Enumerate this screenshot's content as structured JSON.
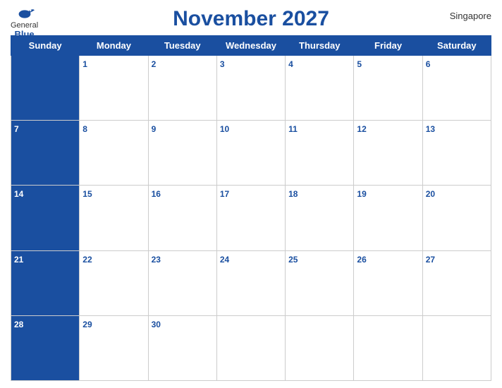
{
  "header": {
    "title": "November 2027",
    "location": "Singapore",
    "logo": {
      "general": "General",
      "blue": "Blue"
    }
  },
  "weekdays": [
    "Sunday",
    "Monday",
    "Tuesday",
    "Wednesday",
    "Thursday",
    "Friday",
    "Saturday"
  ],
  "weeks": [
    [
      {
        "day": "",
        "blue": true
      },
      {
        "day": "1",
        "blue": false
      },
      {
        "day": "2",
        "blue": false
      },
      {
        "day": "3",
        "blue": false
      },
      {
        "day": "4",
        "blue": false
      },
      {
        "day": "5",
        "blue": false
      },
      {
        "day": "6",
        "blue": false
      }
    ],
    [
      {
        "day": "7",
        "blue": true
      },
      {
        "day": "8",
        "blue": false
      },
      {
        "day": "9",
        "blue": false
      },
      {
        "day": "10",
        "blue": false
      },
      {
        "day": "11",
        "blue": false
      },
      {
        "day": "12",
        "blue": false
      },
      {
        "day": "13",
        "blue": false
      }
    ],
    [
      {
        "day": "14",
        "blue": true
      },
      {
        "day": "15",
        "blue": false
      },
      {
        "day": "16",
        "blue": false
      },
      {
        "day": "17",
        "blue": false
      },
      {
        "day": "18",
        "blue": false
      },
      {
        "day": "19",
        "blue": false
      },
      {
        "day": "20",
        "blue": false
      }
    ],
    [
      {
        "day": "21",
        "blue": true
      },
      {
        "day": "22",
        "blue": false
      },
      {
        "day": "23",
        "blue": false
      },
      {
        "day": "24",
        "blue": false
      },
      {
        "day": "25",
        "blue": false
      },
      {
        "day": "26",
        "blue": false
      },
      {
        "day": "27",
        "blue": false
      }
    ],
    [
      {
        "day": "28",
        "blue": true
      },
      {
        "day": "29",
        "blue": false
      },
      {
        "day": "30",
        "blue": false
      },
      {
        "day": "",
        "blue": false
      },
      {
        "day": "",
        "blue": false
      },
      {
        "day": "",
        "blue": false
      },
      {
        "day": "",
        "blue": false
      }
    ]
  ]
}
